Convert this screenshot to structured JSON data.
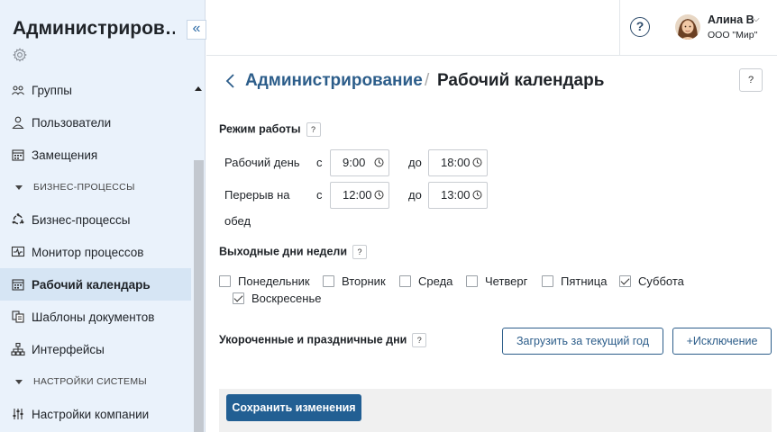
{
  "app": {
    "title": "Администриров…",
    "collapse_glyph": "«"
  },
  "sidebar": {
    "items": [
      {
        "id": "groups",
        "label": "Группы",
        "icon": "users-group-icon"
      },
      {
        "id": "users",
        "label": "Пользователи",
        "icon": "user-icon"
      },
      {
        "id": "substitutions",
        "label": "Замещения",
        "icon": "calendar-icon"
      },
      {
        "id": "section-bp",
        "label": "БИЗНЕС-ПРОЦЕССЫ",
        "section": true
      },
      {
        "id": "bp",
        "label": "Бизнес-процессы",
        "icon": "process-icon"
      },
      {
        "id": "monitor",
        "label": "Монитор процессов",
        "icon": "monitor-icon"
      },
      {
        "id": "calendar",
        "label": "Рабочий календарь",
        "icon": "calendar-icon",
        "active": true
      },
      {
        "id": "templates",
        "label": "Шаблоны документов",
        "icon": "document-template-icon"
      },
      {
        "id": "interfaces",
        "label": "Интерфейсы",
        "icon": "hierarchy-icon"
      },
      {
        "id": "section-settings",
        "label": "НАСТРОЙКИ СИСТЕМЫ",
        "section": true
      },
      {
        "id": "company",
        "label": "Настройки компании",
        "icon": "sliders-icon"
      }
    ]
  },
  "header": {
    "help_glyph": "?",
    "user": {
      "name": "Алина В",
      "org": "ООО \"Мир\"",
      "chevron": "⌵"
    }
  },
  "page": {
    "breadcrumb": "Администрирование",
    "separator": "/",
    "title": "Рабочий календарь",
    "help_glyph": "?"
  },
  "work_mode": {
    "title": "Режим работы",
    "help_glyph": "?",
    "from_label": "с",
    "to_label": "до",
    "workday": {
      "label": "Рабочий день",
      "from": "9:00",
      "to": "18:00"
    },
    "break": {
      "label_line1": "Перерыв на",
      "label_line2": "обед",
      "from": "12:00",
      "to": "13:00"
    }
  },
  "weekends": {
    "title": "Выходные дни недели",
    "help_glyph": "?",
    "days": [
      {
        "label": "Понедельник",
        "checked": false
      },
      {
        "label": "Вторник",
        "checked": false
      },
      {
        "label": "Среда",
        "checked": false
      },
      {
        "label": "Четверг",
        "checked": false
      },
      {
        "label": "Пятница",
        "checked": false
      },
      {
        "label": "Суббота",
        "checked": true
      },
      {
        "label": "Воскресенье",
        "checked": true
      }
    ]
  },
  "holidays": {
    "title": "Укороченные и праздничные дни",
    "help_glyph": "?",
    "load_button": "Загрузить за текущий год",
    "exception_button": "+Исключение"
  },
  "footer": {
    "save_button": "Сохранить изменения"
  },
  "colors": {
    "accent": "#225f93",
    "sidebar_bg": "#eaf2fb",
    "active_item_bg": "#d6e5f4",
    "link": "#2c5d8a"
  }
}
